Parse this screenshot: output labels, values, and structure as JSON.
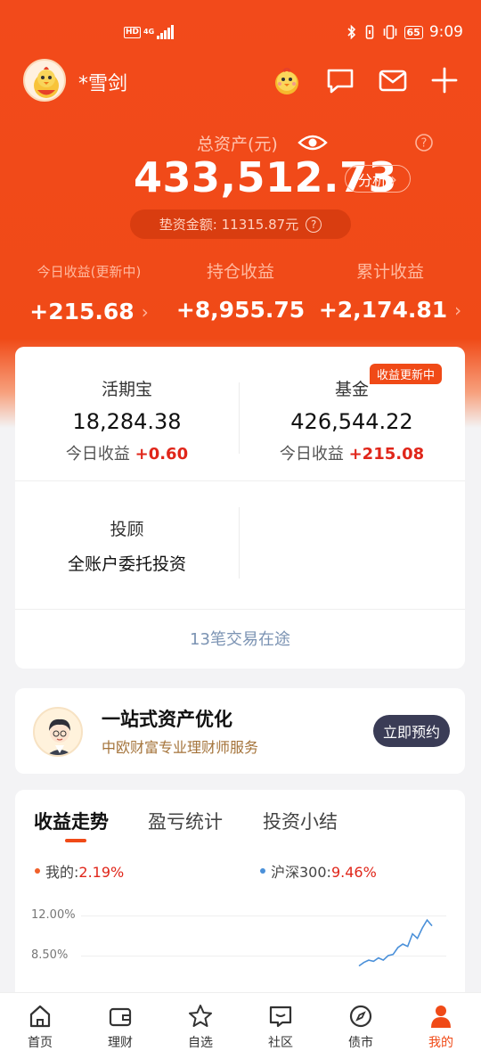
{
  "status_bar": {
    "hd": "HD",
    "network": "4G",
    "battery": "65",
    "time": "9:09"
  },
  "header": {
    "username": "*雪剑"
  },
  "summary": {
    "total_label": "总资产(元)",
    "total_value": "433,512.73",
    "analyze_label": "分析",
    "advance_label": "垫资金额:",
    "advance_value": "11315.87元"
  },
  "earnings": [
    {
      "label": "今日收益(更新中)",
      "value": "+215.68"
    },
    {
      "label": "持仓收益",
      "value": "+8,955.75"
    },
    {
      "label": "累计收益",
      "value": "+2,174.81"
    }
  ],
  "accounts": {
    "huoqibao": {
      "title": "活期宝",
      "amount": "18,284.38",
      "today_label": "今日收益",
      "today_value": "+0.60"
    },
    "fund": {
      "title": "基金",
      "amount": "426,544.22",
      "today_label": "今日收益",
      "today_value": "+215.08",
      "badge": "收益更新中"
    },
    "advisory": {
      "title": "投顾",
      "desc": "全账户委托投资"
    },
    "transit": "13笔交易在途"
  },
  "advisor": {
    "title": "一站式资产优化",
    "subtitle": "中欧财富专业理财师服务",
    "button": "立即预约"
  },
  "trend": {
    "tabs": [
      "收益走势",
      "盈亏统计",
      "投资小结"
    ],
    "legend_mine_label": "我的:",
    "legend_mine_value": "2.19%",
    "legend_index_label": "沪深300:",
    "legend_index_value": "9.46%",
    "y_ticks": [
      "12.00%",
      "8.50%"
    ]
  },
  "chart_data": {
    "type": "line",
    "title": "",
    "xlabel": "",
    "ylabel": "",
    "ylim_visible": [
      8.5,
      12.0
    ],
    "series": [
      {
        "name": "我的",
        "note_visible_range_only": true,
        "values": []
      },
      {
        "name": "沪深300",
        "values": [
          7.6,
          7.9,
          8.1,
          8.0,
          8.3,
          8.1,
          8.5,
          8.6,
          9.2,
          9.5,
          9.3,
          10.4,
          10.0,
          10.9,
          11.6,
          11.1
        ]
      }
    ],
    "grid": true,
    "legend": "top"
  },
  "nav": [
    "首页",
    "理财",
    "自选",
    "社区",
    "债市",
    "我的"
  ],
  "colors": {
    "brand": "#f04a17",
    "gain": "#e0261a",
    "index_line": "#4a90d9"
  }
}
